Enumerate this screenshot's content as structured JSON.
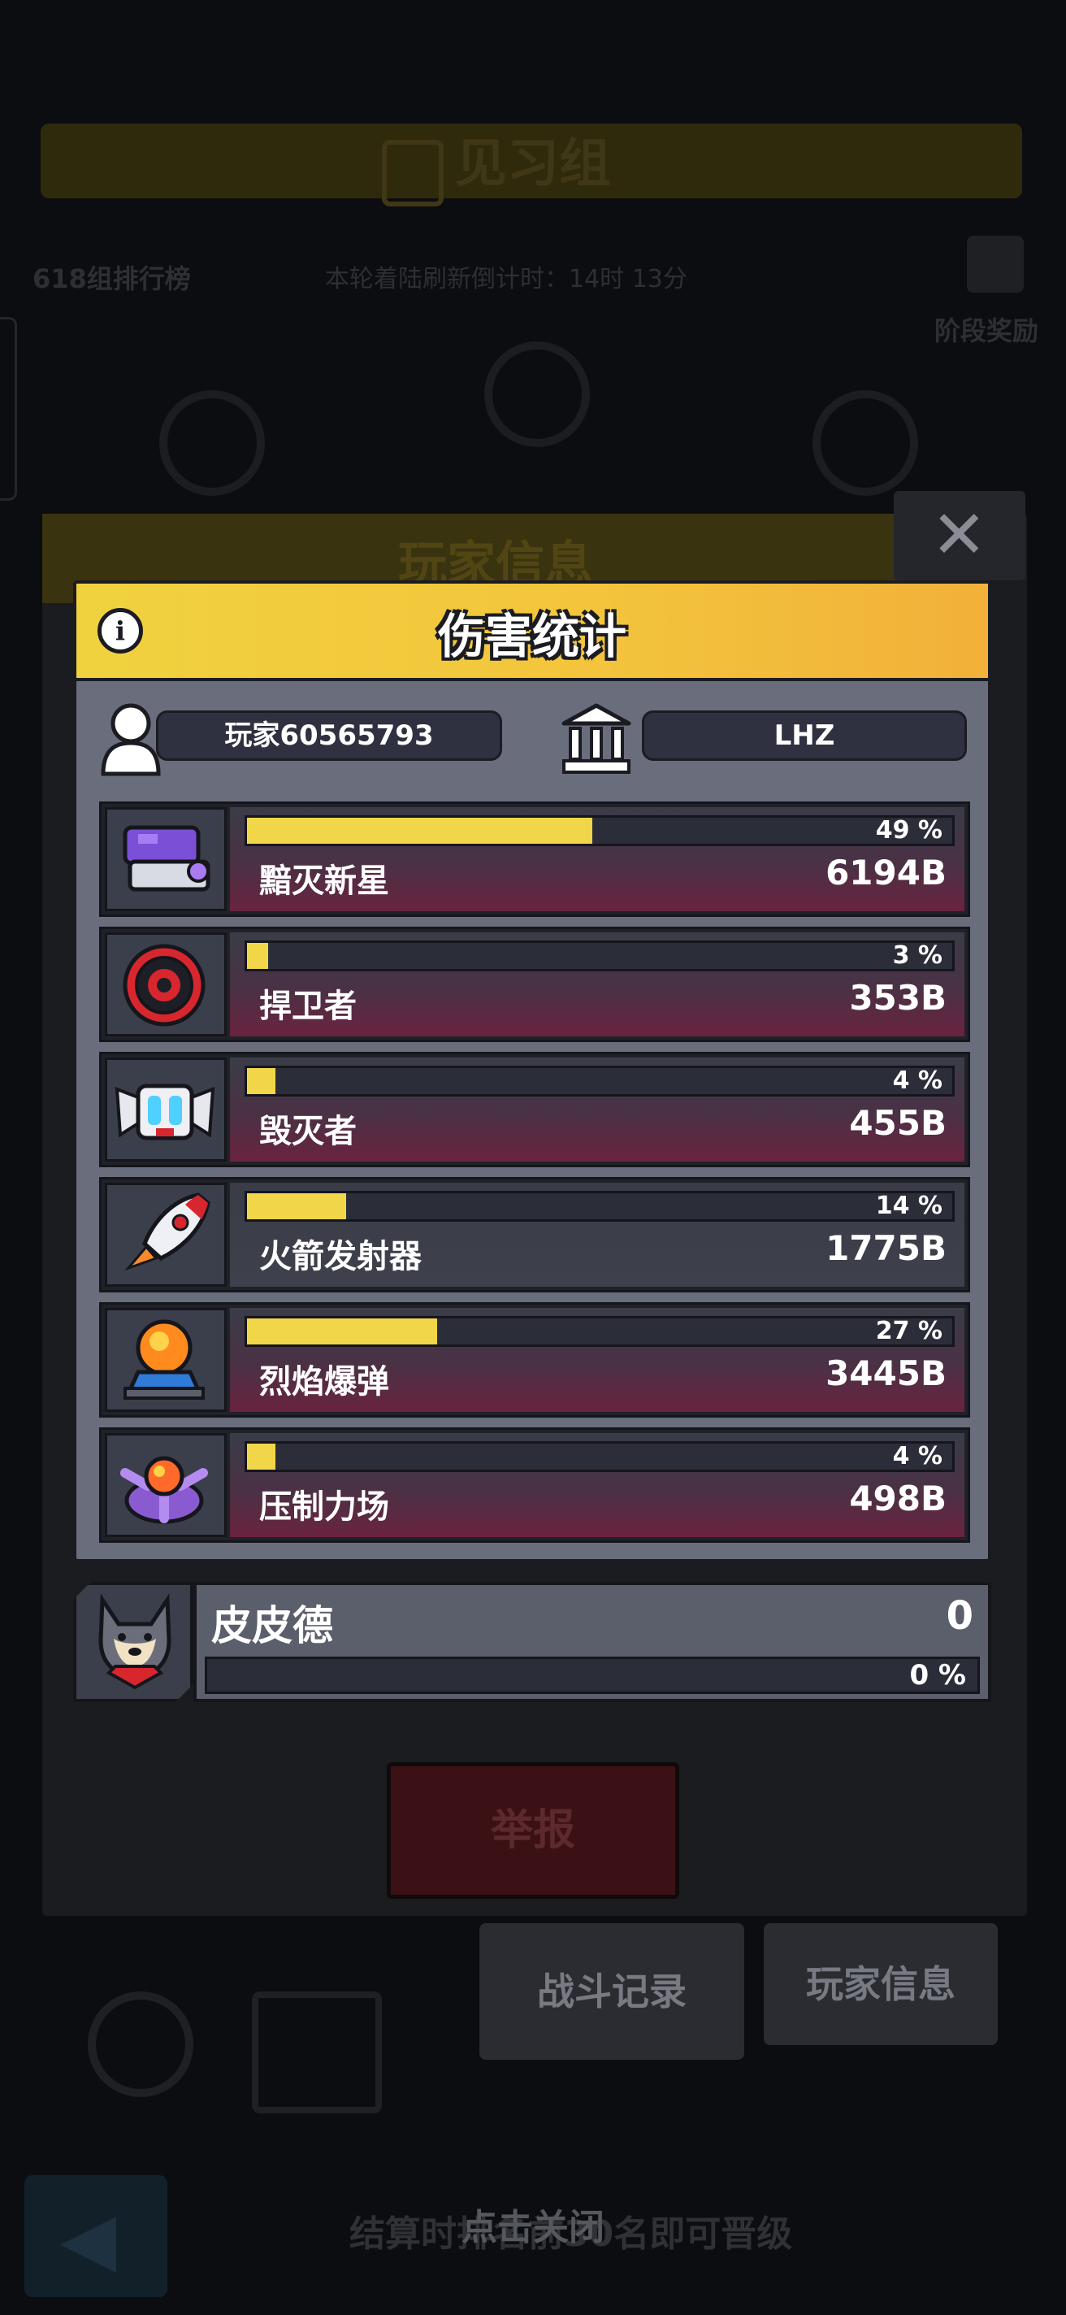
{
  "background": {
    "banner_title": "见习组",
    "rank_link": "618组排行榜",
    "countdown": "本轮着陆刷新倒计时：14时 13分",
    "stage_reward": "阶段奖励",
    "panel_title": "玩家信息",
    "report_button": "举报",
    "tab_battle_record": "战斗记录",
    "tab_player_info": "玩家信息",
    "footer_hint": "结算时排名前30名即可晋级"
  },
  "tap_to_close": "点击关闭",
  "dialog": {
    "title": "伤害统计",
    "player_name": "玩家60565793",
    "guild_name": "LHZ"
  },
  "weapons": [
    {
      "name": "黯灭新星",
      "percent_label": "49 %",
      "fraction": 0.49,
      "value": "6194B",
      "icon": "purple-cannon-icon"
    },
    {
      "name": "捍卫者",
      "percent_label": "3 %",
      "fraction": 0.03,
      "value": "353B",
      "icon": "red-shield-ring-icon"
    },
    {
      "name": "毁灭者",
      "percent_label": "4 %",
      "fraction": 0.04,
      "value": "455B",
      "icon": "robot-drone-icon"
    },
    {
      "name": "火箭发射器",
      "percent_label": "14 %",
      "fraction": 0.14,
      "value": "1775B",
      "icon": "rocket-icon"
    },
    {
      "name": "烈焰爆弹",
      "percent_label": "27 %",
      "fraction": 0.27,
      "value": "3445B",
      "icon": "flame-bomb-icon"
    },
    {
      "name": "压制力场",
      "percent_label": "4 %",
      "fraction": 0.04,
      "value": "498B",
      "icon": "force-field-icon"
    }
  ],
  "pet": {
    "name": "皮皮德",
    "value": "0",
    "percent_label": "0 %",
    "fraction": 0,
    "icon": "dog-avatar-icon"
  },
  "colors": {
    "header_yellow": "#f3c53c",
    "bar_fill": "#f1d64a",
    "row_gradient_red": "#6a2340"
  }
}
